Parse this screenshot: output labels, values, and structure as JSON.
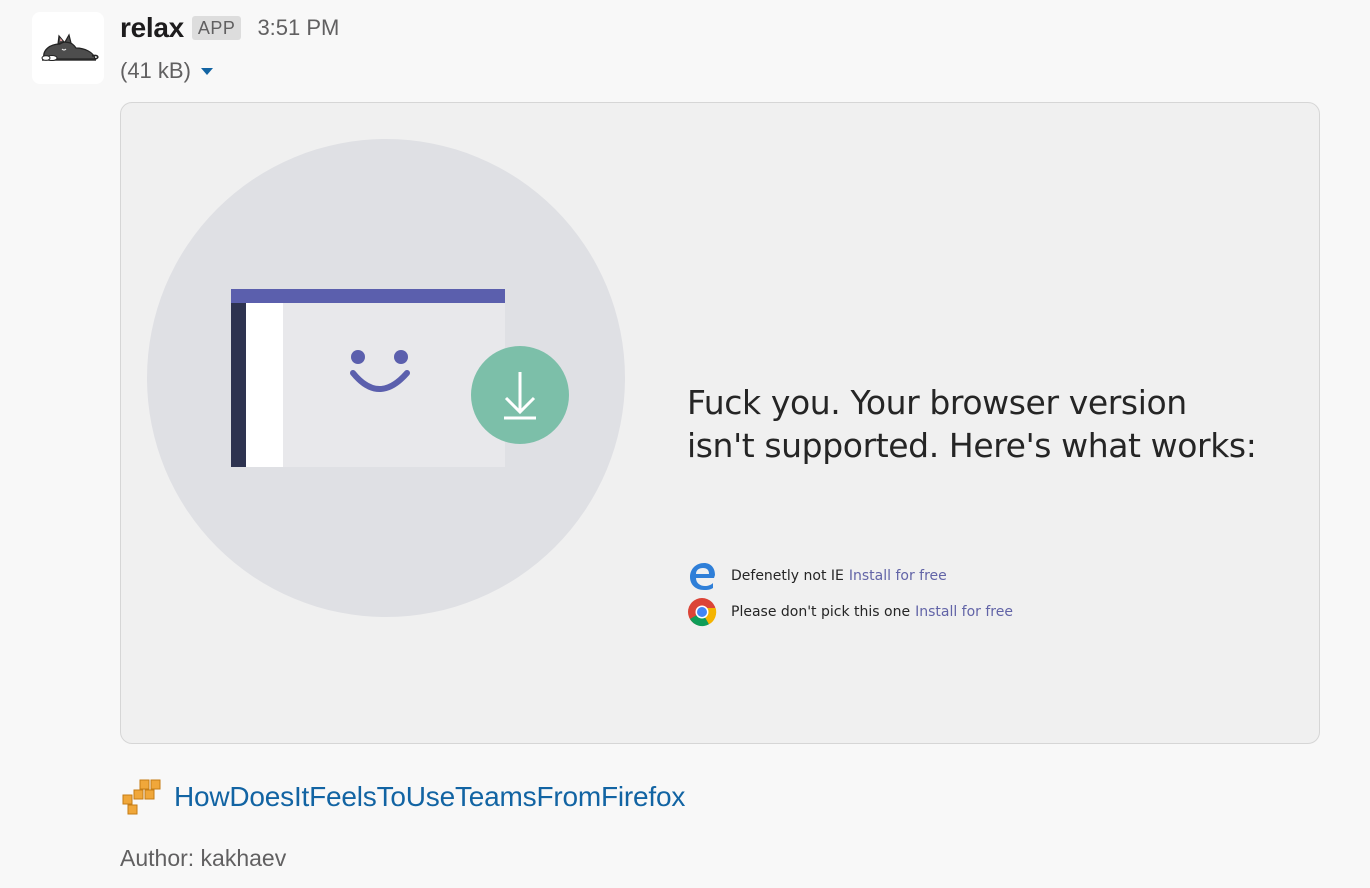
{
  "message": {
    "sender": "relax",
    "badge": "APP",
    "timestamp": "3:51 PM",
    "file_size": "(41 kB)",
    "avatar_icon": "sleeping-cat-icon"
  },
  "preview": {
    "headline_line1": "Fuck you. Your browser version",
    "headline_line2": "isn't supported. Here's what works:",
    "browsers": [
      {
        "name": "Defenetly not IE",
        "link": "Install for free",
        "icon": "edge-icon"
      },
      {
        "name": "Please don't pick this one",
        "link": "Install for free",
        "icon": "chrome-icon"
      }
    ],
    "colors": {
      "teams_purple": "#5b5fad",
      "download_green": "#7cbfa9",
      "link_purple": "#6264a7"
    }
  },
  "attachment": {
    "title": "HowDoesItFeelsToUseTeamsFromFirefox",
    "title_icon": "aws-boxes-icon",
    "author": "Author: kakhaev"
  },
  "colors": {
    "link_blue": "#1264a3",
    "muted_text": "#616061"
  }
}
